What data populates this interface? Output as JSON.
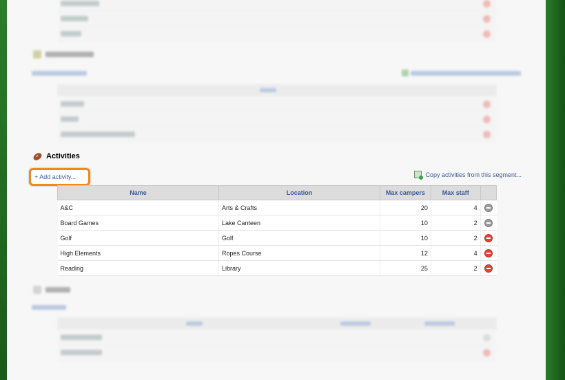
{
  "activities": {
    "title": "Activities",
    "add_link": "+ Add activity...",
    "copy_link": "Copy activities from this segment...",
    "columns": {
      "name": "Name",
      "location": "Location",
      "max_campers": "Max campers",
      "max_staff": "Max staff"
    },
    "rows": [
      {
        "name": "A&C",
        "location": "Arts & Crafts",
        "max_campers": "20",
        "max_staff": "4",
        "remove_state": "disabled"
      },
      {
        "name": "Board Games",
        "location": "Lake Canteen",
        "max_campers": "10",
        "max_staff": "2",
        "remove_state": "disabled"
      },
      {
        "name": "Golf",
        "location": "Golf",
        "max_campers": "10",
        "max_staff": "2",
        "remove_state": "enabled"
      },
      {
        "name": "High Elements",
        "location": "Ropes Course",
        "max_campers": "12",
        "max_staff": "4",
        "remove_state": "enabled"
      },
      {
        "name": "Reading",
        "location": "Library",
        "max_campers": "25",
        "max_staff": "2",
        "remove_state": "enabled"
      }
    ]
  },
  "colors": {
    "link": "#3a5b98",
    "highlight_border": "#f08a16",
    "remove_enabled": "#e0463a",
    "remove_disabled": "#9c9c9c",
    "background_green": "#1f6a1f"
  },
  "icons": {
    "activities_section": "football-icon",
    "copy": "copy-segment-icon",
    "remove": "remove-icon"
  }
}
